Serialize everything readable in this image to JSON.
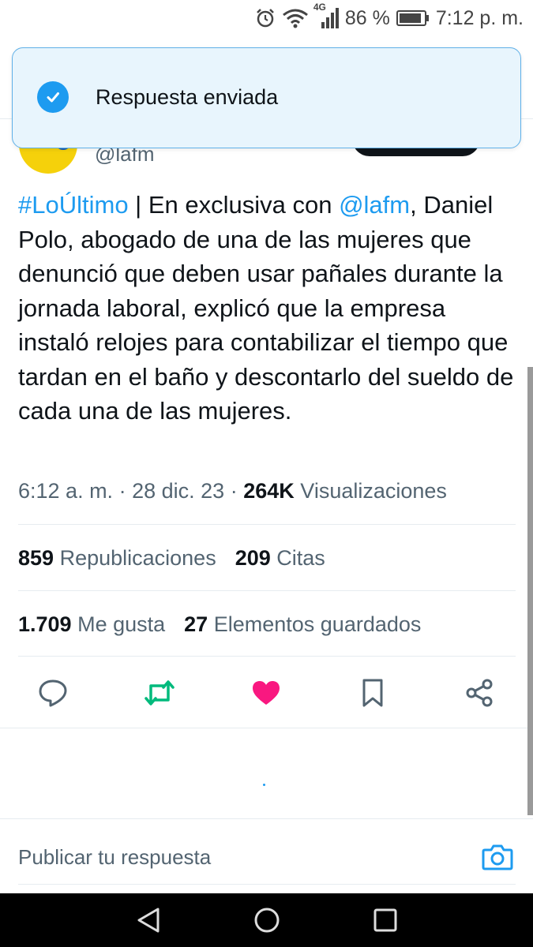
{
  "status_bar": {
    "network": "4G",
    "battery": "86 %",
    "time": "7:12 p. m."
  },
  "toast": {
    "message": "Respuesta enviada"
  },
  "author": {
    "handle": "@lafm"
  },
  "tweet": {
    "hashtag": "#LoÚltimo",
    "text_part1": " | En exclusiva con ",
    "mention": "@lafm",
    "text_part2": ", Daniel Polo, abogado de una de las mujeres que denunció que deben usar pañales durante la jornada laboral, explicó que la empresa instaló relojes para contabilizar el tiempo que tardan en el baño y descontarlo del sueldo de cada una de las mujeres.",
    "time": "6:12 a. m.",
    "date": "28 dic. 23",
    "views_count": "264K",
    "views_label": "Visualizaciones",
    "sep": "·"
  },
  "stats": {
    "reposts_count": "859",
    "reposts_label": "Republicaciones",
    "quotes_count": "209",
    "quotes_label": "Citas",
    "likes_count": "1.709",
    "likes_label": "Me gusta",
    "bookmarks_count": "27",
    "bookmarks_label": "Elementos guardados"
  },
  "actions": [
    "reply-icon",
    "retweet-icon",
    "like-icon",
    "bookmark-icon",
    "share-icon"
  ],
  "colors": {
    "accent": "#1d9bf0",
    "retweet": "#00ba7c",
    "like": "#f91880",
    "toast_bg": "#e8f5fd"
  },
  "reply_bar": {
    "placeholder": "Publicar tu respuesta"
  }
}
